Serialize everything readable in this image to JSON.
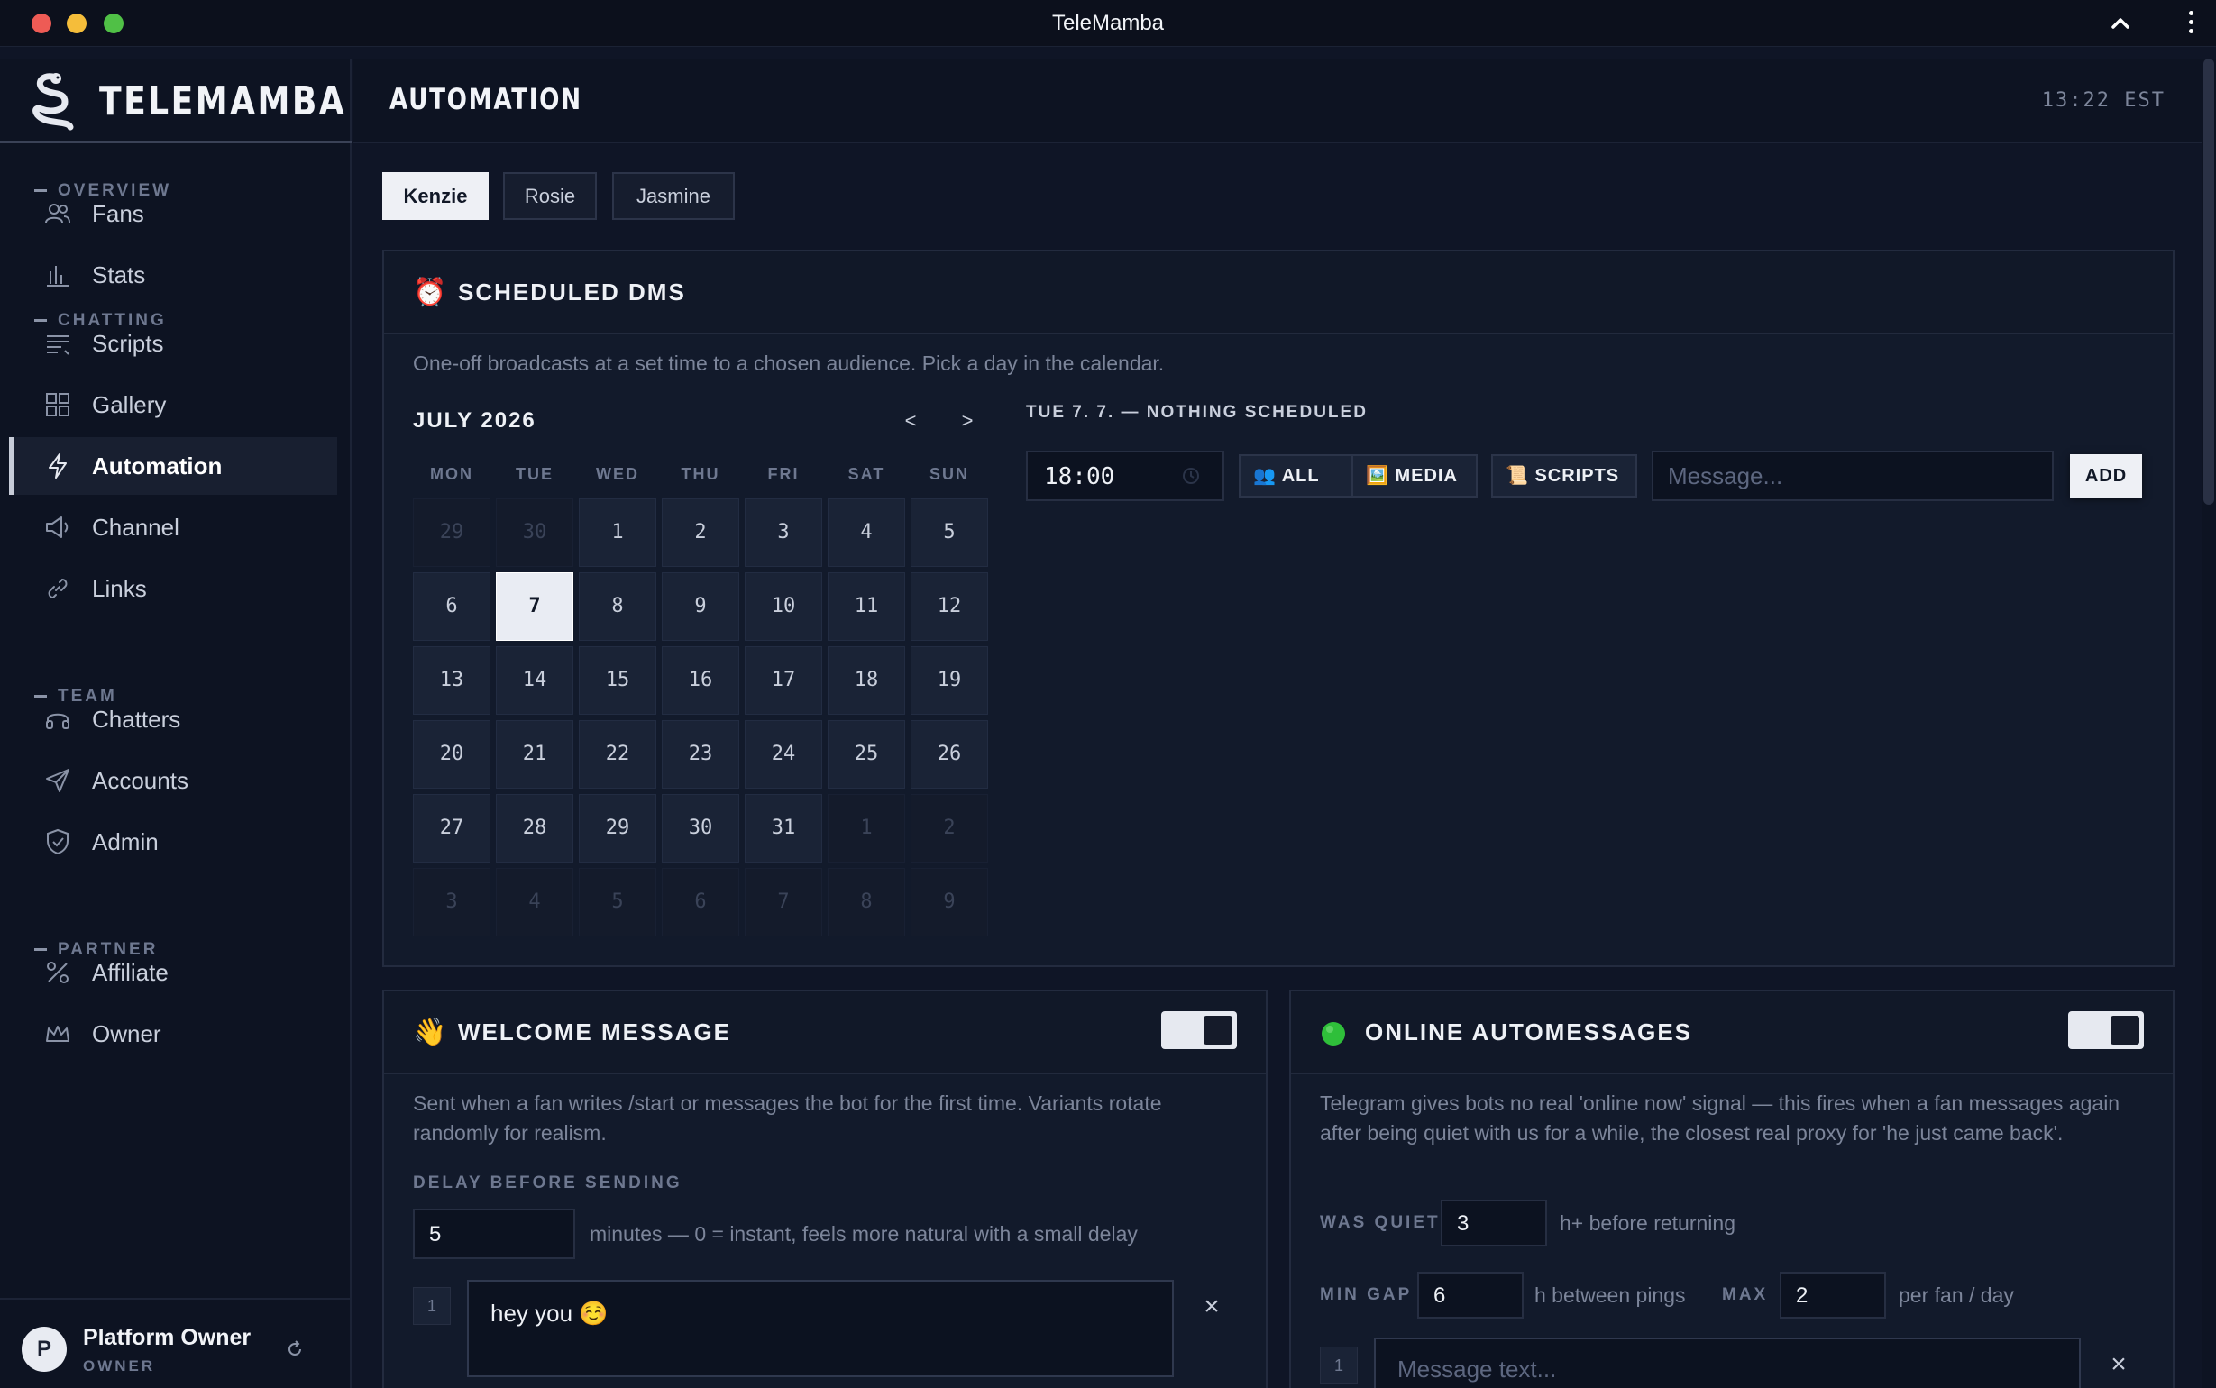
{
  "window": {
    "title": "TeleMamba"
  },
  "brand": {
    "name": "TELEMAMBA"
  },
  "sidebar": {
    "sections": [
      {
        "label": "OVERVIEW"
      },
      {
        "label": "CHATTING"
      },
      {
        "label": "TEAM"
      },
      {
        "label": "PARTNER"
      }
    ],
    "items": [
      {
        "label": "Fans",
        "icon": "users-icon"
      },
      {
        "label": "Stats",
        "icon": "bar-chart-icon"
      },
      {
        "label": "Scripts",
        "icon": "list-icon"
      },
      {
        "label": "Gallery",
        "icon": "grid-icon"
      },
      {
        "label": "Automation",
        "icon": "bolt-icon",
        "active": true
      },
      {
        "label": "Channel",
        "icon": "megaphone-icon"
      },
      {
        "label": "Links",
        "icon": "link-icon"
      },
      {
        "label": "Chatters",
        "icon": "headset-icon"
      },
      {
        "label": "Accounts",
        "icon": "send-icon"
      },
      {
        "label": "Admin",
        "icon": "shield-icon"
      },
      {
        "label": "Affiliate",
        "icon": "percent-icon"
      },
      {
        "label": "Owner",
        "icon": "crown-icon"
      }
    ],
    "user": {
      "initial": "P",
      "name": "Platform Owner",
      "role": "OWNER"
    }
  },
  "header": {
    "title": "AUTOMATION",
    "time": "13:22 EST"
  },
  "profile_tabs": [
    {
      "label": "Kenzie",
      "active": true
    },
    {
      "label": "Rosie"
    },
    {
      "label": "Jasmine"
    }
  ],
  "scheduled": {
    "emoji": "⏰",
    "title": "SCHEDULED DMS",
    "description": "One-off broadcasts at a set time to a chosen audience. Pick a day in the calendar.",
    "calendar": {
      "month_label": "JULY 2026",
      "prev": "<",
      "next": ">",
      "weekdays": [
        "MON",
        "TUE",
        "WED",
        "THU",
        "FRI",
        "SAT",
        "SUN"
      ],
      "days": [
        "29",
        "30",
        "1",
        "2",
        "3",
        "4",
        "5",
        "6",
        "7",
        "8",
        "9",
        "10",
        "11",
        "12",
        "13",
        "14",
        "15",
        "16",
        "17",
        "18",
        "19",
        "20",
        "21",
        "22",
        "23",
        "24",
        "25",
        "26",
        "27",
        "28",
        "29",
        "30",
        "31",
        "1",
        "2",
        "3",
        "4",
        "5",
        "6",
        "7",
        "8",
        "9"
      ],
      "selected_day": "7"
    },
    "day_title": "TUE 7. 7. — NOTHING SCHEDULED",
    "time_value": "18:00",
    "audience_label": "👥 ALL",
    "media_label": "🖼️ MEDIA",
    "scripts_label": "📜 SCRIPTS",
    "message_placeholder": "Message...",
    "add_label": "ADD"
  },
  "welcome": {
    "emoji": "👋",
    "title": "WELCOME MESSAGE",
    "enabled": true,
    "description": "Sent when a fan writes /start or messages the bot for the first time. Variants rotate randomly for realism.",
    "delay_label": "DELAY BEFORE SENDING",
    "delay_value": "5",
    "delay_hint": "minutes — 0 = instant, feels more natural with a small delay",
    "variants": [
      {
        "index": "1",
        "text": "hey you ☺️"
      }
    ]
  },
  "online": {
    "title": "ONLINE AUTOMESSAGES",
    "enabled": true,
    "status_color": "#2fbf3a",
    "description": "Telegram gives bots no real 'online now' signal — this fires when a fan messages again after being quiet with us for a while, the closest real proxy for 'he just came back'.",
    "quiet_label": "WAS QUIET",
    "quiet_value": "3",
    "quiet_hint": "h+ before returning",
    "gap_label": "MIN GAP",
    "gap_value": "6",
    "gap_hint": "h between pings",
    "max_label": "MAX",
    "max_value": "2",
    "max_hint": "per fan / day",
    "messages": [
      {
        "index": "1",
        "placeholder": "Message text..."
      }
    ]
  },
  "colors": {
    "background": "#0f1526",
    "accent": "#eef0f5",
    "muted": "#7c859a"
  }
}
